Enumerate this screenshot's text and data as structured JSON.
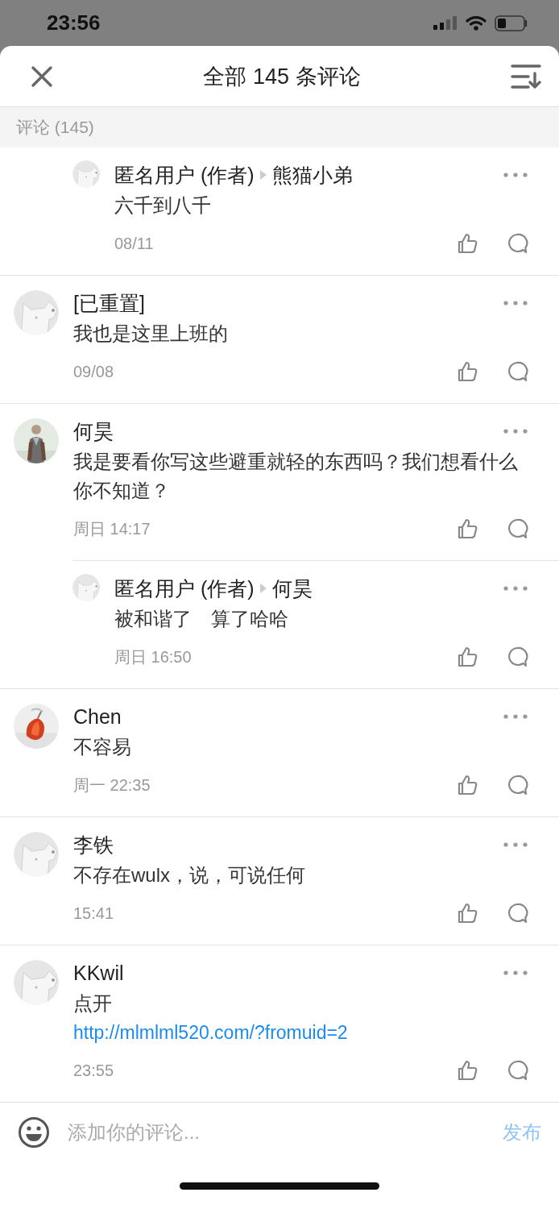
{
  "status_bar": {
    "time": "23:56"
  },
  "header": {
    "title": "全部 145 条评论"
  },
  "section": {
    "label": "评论 (145)"
  },
  "comments": [
    {
      "kind": "reply",
      "avatar": {
        "kind": "default"
      },
      "author": "匿名用户 (作者)",
      "target": "熊猫小弟",
      "text": "六千到八千",
      "time": "08/11"
    },
    {
      "kind": "comment",
      "avatar": {
        "kind": "default"
      },
      "author": "[已重置]",
      "text": "我也是这里上班的",
      "time": "09/08"
    },
    {
      "kind": "comment",
      "author": "何昊",
      "text": "我是要看你写这些避重就轻的东西吗？我们想看什么你不知道？",
      "time": "周日 14:17"
    },
    {
      "kind": "reply",
      "avatar": {
        "kind": "default"
      },
      "author": "匿名用户 (作者)",
      "target": "何昊",
      "text": "被和谐了　算了哈哈",
      "time": "周日 16:50"
    },
    {
      "kind": "comment",
      "author": "Chen",
      "text": "不容易",
      "time": "周一 22:35"
    },
    {
      "kind": "comment",
      "avatar": {
        "kind": "default"
      },
      "author": "李铁",
      "text": "不存在wulx，说，可说任何",
      "time": "15:41"
    },
    {
      "kind": "comment",
      "avatar": {
        "kind": "default"
      },
      "author": "KKwil",
      "text": "点开",
      "link": "http://mlmlml520.com/?fromuid=2",
      "time": "23:55"
    }
  ],
  "composer": {
    "placeholder": "添加你的评论...",
    "submit": {
      "label": "发布",
      "disabled": true
    }
  }
}
